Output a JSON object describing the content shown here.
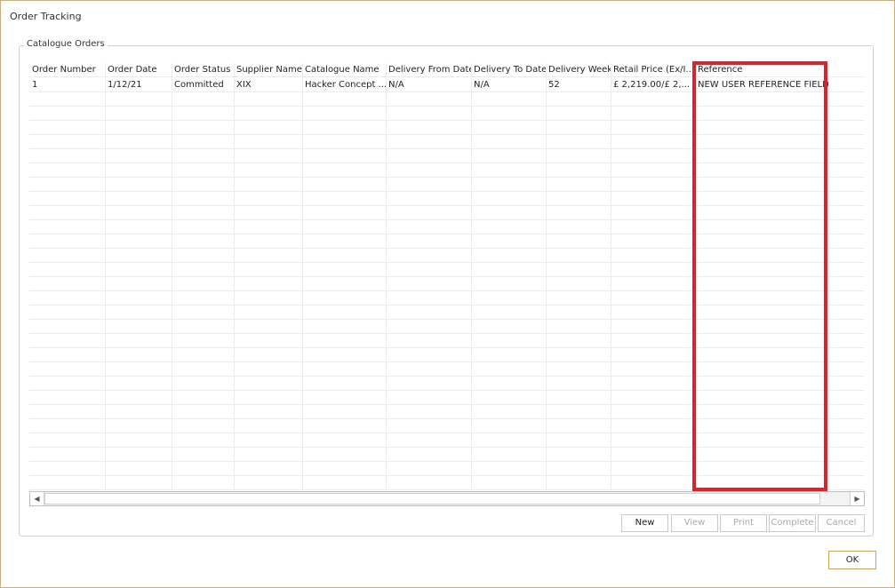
{
  "window": {
    "title": "Order Tracking"
  },
  "group": {
    "legend": "Catalogue Orders"
  },
  "grid": {
    "columns": [
      "Order Number",
      "Order Date",
      "Order Status",
      "Supplier Name",
      "Catalogue Name",
      "Delivery From Date",
      "Delivery To Date",
      "Delivery Week",
      "Retail Price (Ex/I...",
      "Reference"
    ],
    "rows": [
      [
        "1",
        "1/12/21",
        "Committed",
        "XIX",
        "Hacker Concept ...",
        "N/A",
        "N/A",
        "52",
        "£ 2,219.00/£ 2,...",
        "NEW USER REFERENCE FIELD"
      ]
    ]
  },
  "buttons": {
    "new": "New",
    "view": "View",
    "print": "Print",
    "complete": "Complete",
    "cancel": "Cancel",
    "ok": "OK"
  },
  "scroll": {
    "left_icon": "triangle-left-icon",
    "right_icon": "triangle-right-icon"
  },
  "colors": {
    "highlight": "#d9232e",
    "window_border": "#c8b178"
  }
}
